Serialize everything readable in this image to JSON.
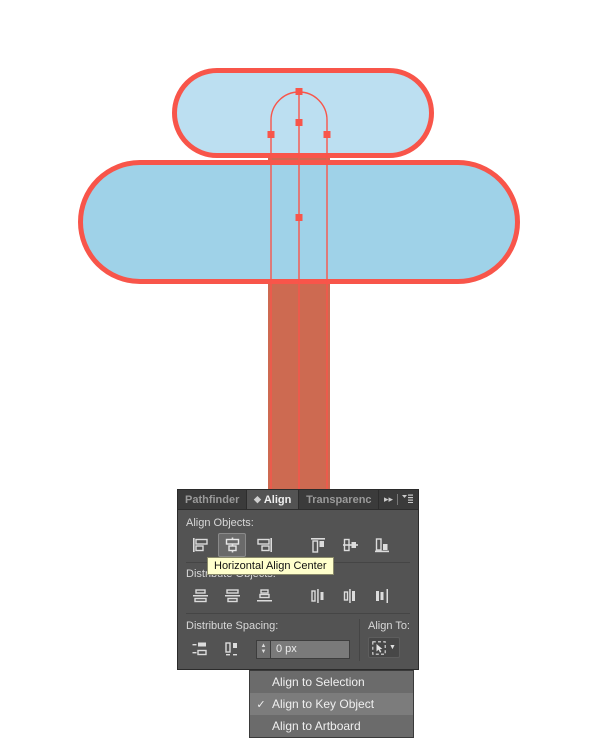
{
  "artwork": {
    "stroke_color": "#f8554a",
    "upper_shape_fill": "#bcdff1",
    "lower_shape_fill": "#9fd2e8",
    "post_fill": "#cd6a51",
    "anchor_color": "#f8554a"
  },
  "panel": {
    "tabs": [
      {
        "label": "Pathfinder",
        "active": false
      },
      {
        "label": "Align",
        "active": true
      },
      {
        "label": "Transparenc",
        "active": false
      }
    ],
    "header_icons": [
      {
        "name": "expand-panel-icon",
        "glyph": "▸▸"
      },
      {
        "name": "panel-menu-icon",
        "glyph": "≡"
      }
    ],
    "align_objects": {
      "label": "Align Objects:",
      "buttons": [
        {
          "name": "horizontal-align-left",
          "active": false
        },
        {
          "name": "horizontal-align-center",
          "active": true
        },
        {
          "name": "horizontal-align-right",
          "active": false
        },
        {
          "name": "vertical-align-top",
          "active": false
        },
        {
          "name": "vertical-align-center",
          "active": false
        },
        {
          "name": "vertical-align-bottom",
          "active": false
        }
      ]
    },
    "distribute_objects": {
      "label": "Distribute Objects:",
      "buttons": [
        {
          "name": "vertical-distribute-top",
          "active": false
        },
        {
          "name": "vertical-distribute-center",
          "active": false
        },
        {
          "name": "vertical-distribute-bottom",
          "active": false
        },
        {
          "name": "horizontal-distribute-left",
          "active": false
        },
        {
          "name": "horizontal-distribute-center",
          "active": false
        },
        {
          "name": "horizontal-distribute-right",
          "active": false
        }
      ]
    },
    "distribute_spacing": {
      "label": "Distribute Spacing:",
      "buttons": [
        {
          "name": "vertical-distribute-spacing",
          "active": false
        },
        {
          "name": "horizontal-distribute-spacing",
          "active": false
        }
      ],
      "value": "0 px"
    },
    "align_to": {
      "label": "Align To:",
      "selected_icon": "align-to-key-object-icon"
    }
  },
  "tooltip": {
    "text": "Horizontal Align Center",
    "background": "#ffffcc"
  },
  "dropdown": {
    "items": [
      {
        "label": "Align to Selection",
        "checked": false
      },
      {
        "label": "Align to Key Object",
        "checked": true
      },
      {
        "label": "Align to Artboard",
        "checked": false
      }
    ],
    "check_glyph": "✓"
  }
}
